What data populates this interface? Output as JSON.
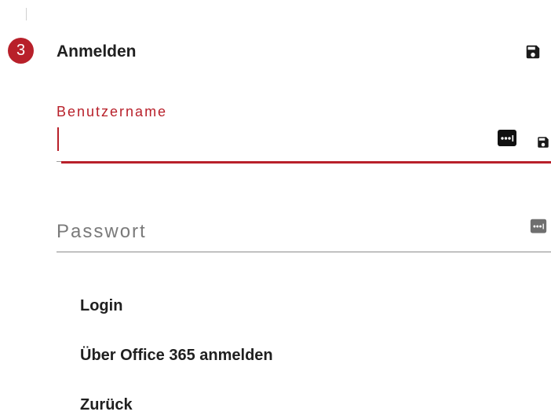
{
  "step": {
    "number": "3",
    "title": "Anmelden",
    "badge_color": "#b8202a"
  },
  "icons": {
    "header_save": "floppy-disk-icon",
    "field_password_manager": "password-dots-icon",
    "field_save": "floppy-disk-icon"
  },
  "username": {
    "label": "Benutzername",
    "value": "",
    "state": "focused",
    "accent_color": "#b8202a"
  },
  "password": {
    "placeholder": "Passwort",
    "value": ""
  },
  "actions": {
    "login": "Login",
    "office365": "Über Office 365 anmelden",
    "back": "Zurück"
  }
}
